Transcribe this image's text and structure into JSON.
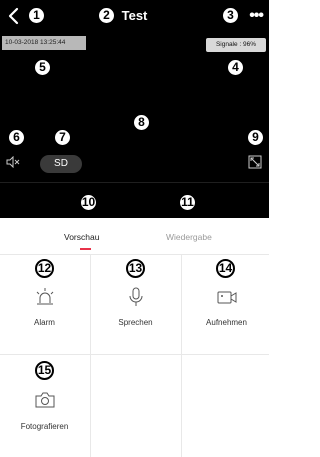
{
  "header": {
    "back_icon": "chevron-left-icon",
    "title": "Test",
    "more_icon": "more-dots-icon"
  },
  "video": {
    "timestamp": "10-03-2018  13:25:44",
    "signal": "Signale : 96%",
    "mute_icon": "speaker-mute-icon",
    "sd_label": "SD",
    "fullscreen_icon": "fullscreen-icon"
  },
  "tabs": [
    {
      "label": "Vorschau",
      "active": true
    },
    {
      "label": "Wiedergabe",
      "active": false
    }
  ],
  "actions": [
    {
      "label": "Alarm",
      "icon": "alarm-light-icon"
    },
    {
      "label": "Sprechen",
      "icon": "microphone-icon"
    },
    {
      "label": "Aufnehmen",
      "icon": "video-camera-icon"
    },
    {
      "label": "Fotografieren",
      "icon": "camera-icon"
    }
  ],
  "callouts": [
    "1",
    "2",
    "3",
    "4",
    "5",
    "6",
    "7",
    "8",
    "9",
    "10",
    "11",
    "12",
    "13",
    "14",
    "15"
  ],
  "colors": {
    "accent": "#e8324a",
    "video_bg": "#000000",
    "badge_bg": "#ffffff"
  }
}
